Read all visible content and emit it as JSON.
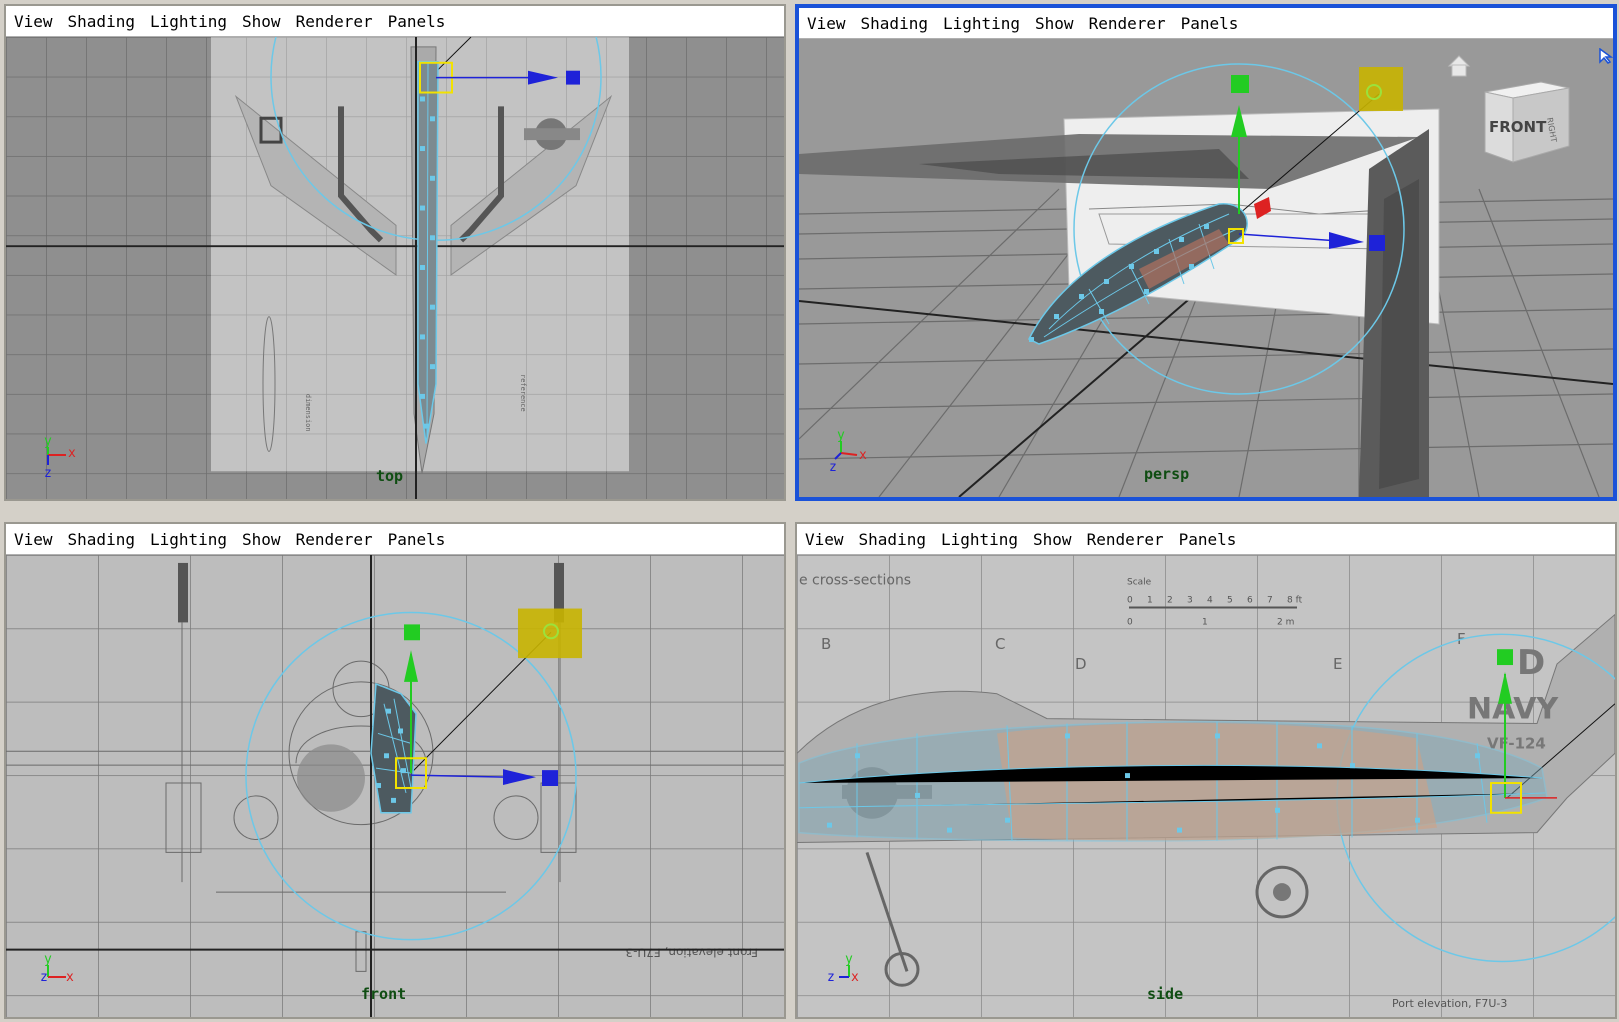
{
  "menu": [
    "View",
    "Shading",
    "Lighting",
    "Show",
    "Renderer",
    "Panels"
  ],
  "viewports": {
    "top": {
      "camera": "top",
      "axes": {
        "a": "y",
        "b": "x",
        "c": "z"
      }
    },
    "persp": {
      "camera": "persp",
      "axes": {
        "a": "y",
        "b": "x",
        "c": "z"
      },
      "viewcube": "FRONT",
      "viewcube_side": "RIGHT"
    },
    "front": {
      "camera": "front",
      "axes": {
        "a": "y",
        "b": "x",
        "c": "z"
      },
      "blueprint_text": "Front elevation, F7U-3"
    },
    "side": {
      "camera": "side",
      "axes": {
        "a": "y",
        "b": "x",
        "c": "z"
      },
      "blueprint": {
        "header": "e cross-sections",
        "scale": "Scale",
        "scale_ticks": [
          "0",
          "1",
          "2",
          "3",
          "4",
          "5",
          "6",
          "7",
          "8 ft"
        ],
        "scale_m": [
          "0",
          "1",
          "2 m"
        ],
        "tail": "NAVY",
        "tail_letter": "D",
        "tail_num": "VF-124",
        "sections": [
          "B",
          "C",
          "D",
          "E",
          "F"
        ],
        "footer": "Port elevation, F7U-3"
      }
    }
  },
  "colors": {
    "active_border": "#1a52d8",
    "mesh": "#6cc8e8",
    "manip_x": "#1e22d8",
    "manip_y": "#22cc22",
    "manip_z": "#dd2222",
    "light_handle": "#c8b400",
    "cam_label": "#0f4d12"
  }
}
